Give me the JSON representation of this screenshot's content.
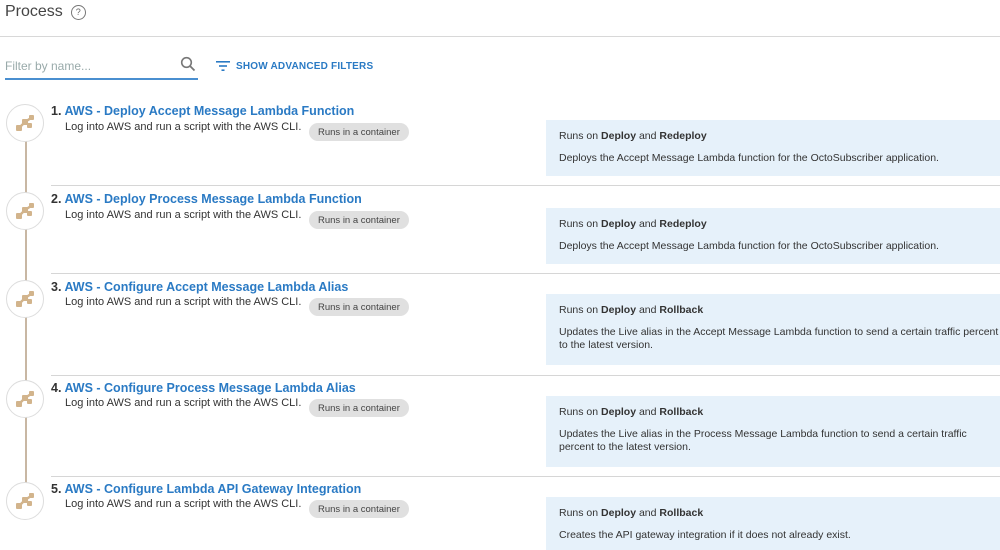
{
  "header": {
    "title": "Process",
    "help_icon": "?"
  },
  "filter": {
    "placeholder": "Filter by name...",
    "value": ""
  },
  "advanced_filters": {
    "label": "SHOW ADVANCED FILTERS"
  },
  "steps": [
    {
      "number": "1.",
      "title": "AWS - Deploy Accept Message Lambda Function",
      "description": "Log into AWS and run a script with the AWS CLI.",
      "badge": "Runs in a container",
      "runs_prefix": "Runs on",
      "runs_on_1": "Deploy",
      "runs_and": "and",
      "runs_on_2": "Redeploy",
      "notes": "Deploys the Accept Message Lambda function for the OctoSubscriber application."
    },
    {
      "number": "2.",
      "title": "AWS - Deploy Process Message Lambda Function",
      "description": "Log into AWS and run a script with the AWS CLI.",
      "badge": "Runs in a container",
      "runs_prefix": "Runs on",
      "runs_on_1": "Deploy",
      "runs_and": "and",
      "runs_on_2": "Redeploy",
      "notes": "Deploys the Accept Message Lambda function for the OctoSubscriber application."
    },
    {
      "number": "3.",
      "title": "AWS - Configure Accept Message Lambda Alias",
      "description": "Log into AWS and run a script with the AWS CLI.",
      "badge": "Runs in a container",
      "runs_prefix": "Runs on",
      "runs_on_1": "Deploy",
      "runs_and": "and",
      "runs_on_2": "Rollback",
      "notes": "Updates the Live alias in the Accept Message Lambda function to send a certain traffic percent to the latest version."
    },
    {
      "number": "4.",
      "title": "AWS - Configure Process Message Lambda Alias",
      "description": "Log into AWS and run a script with the AWS CLI.",
      "badge": "Runs in a container",
      "runs_prefix": "Runs on",
      "runs_on_1": "Deploy",
      "runs_and": "and",
      "runs_on_2": "Rollback",
      "notes": "Updates the Live alias in the Process Message Lambda function to send a certain traffic percent to the latest version."
    },
    {
      "number": "5.",
      "title": "AWS - Configure Lambda API Gateway Integration",
      "description": "Log into AWS and run a script with the AWS CLI.",
      "badge": "Runs in a container",
      "runs_prefix": "Runs on",
      "runs_on_1": "Deploy",
      "runs_and": "and",
      "runs_on_2": "Rollback",
      "notes": "Creates the API gateway integration if it does not already exist."
    }
  ],
  "colors": {
    "link": "#2a7ac4",
    "info_bg": "#e6f1fa",
    "timeline": "#c8b7a3",
    "icon_tint": "#d2b48c"
  }
}
